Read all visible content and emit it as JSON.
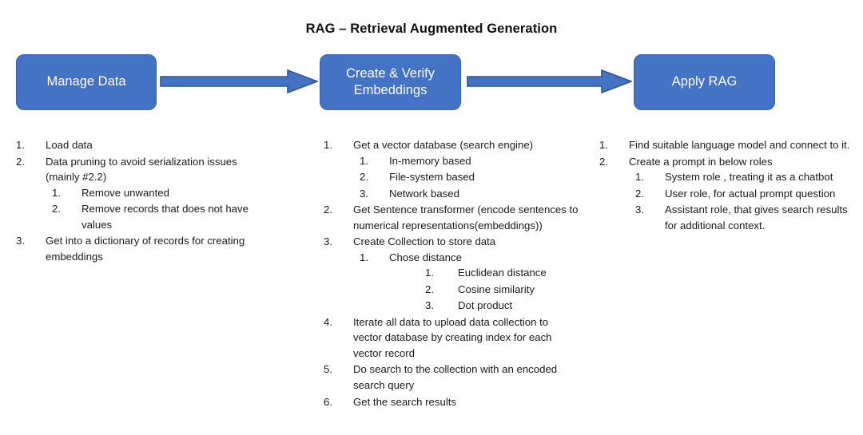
{
  "title": "RAG – Retrieval Augmented Generation",
  "colors": {
    "box_fill": "#4472C4",
    "box_border": "#3A63B0",
    "box_text": "#FFFFFF",
    "arrow_fill": "#4472C4",
    "arrow_border": "#2F5597",
    "page_background": "#FFFFFF",
    "body_text": "#1A1A1A"
  },
  "flow": {
    "boxes": [
      {
        "label": "Manage Data"
      },
      {
        "label": "Create & Verify Embeddings"
      },
      {
        "label": "Apply RAG"
      }
    ],
    "arrows": [
      {
        "name": "arrow-manage-to-embeddings",
        "direction": "right"
      },
      {
        "name": "arrow-embeddings-to-apply",
        "direction": "right"
      }
    ]
  },
  "columns": [
    {
      "name": "manage-data-steps",
      "items": [
        {
          "num": "1.",
          "text": "Load data"
        },
        {
          "num": "2.",
          "text": "Data pruning to avoid serialization issues (mainly #2.2)",
          "children": [
            {
              "num": "1.",
              "text": "Remove unwanted"
            },
            {
              "num": "2.",
              "text": "Remove records that does not have values"
            }
          ]
        },
        {
          "num": "3.",
          "text": "Get into a dictionary of records for creating embeddings"
        }
      ]
    },
    {
      "name": "create-verify-embeddings-steps",
      "items": [
        {
          "num": "1.",
          "text": "Get a vector database (search engine)",
          "children": [
            {
              "num": "1.",
              "text": "In-memory based"
            },
            {
              "num": "2.",
              "text": "File-system based"
            },
            {
              "num": "3.",
              "text": "Network based"
            }
          ]
        },
        {
          "num": "2.",
          "text": "Get Sentence transformer (encode sentences to numerical representations(embeddings))"
        },
        {
          "num": "3.",
          "text": "Create Collection to store data",
          "children": [
            {
              "num": "1.",
              "text": "Chose distance",
              "children": [
                {
                  "num": "1.",
                  "text": "Euclidean distance"
                },
                {
                  "num": "2.",
                  "text": "Cosine similarity"
                },
                {
                  "num": "3.",
                  "text": "Dot product"
                }
              ]
            }
          ]
        },
        {
          "num": "4.",
          "text": "Iterate all data to upload data collection to vector database by creating index for each vector record"
        },
        {
          "num": "5.",
          "text": "Do search to the collection with an encoded search query"
        },
        {
          "num": "6.",
          "text": "Get the search results"
        }
      ]
    },
    {
      "name": "apply-rag-steps",
      "items": [
        {
          "num": "1.",
          "text": "Find suitable language model and connect to it."
        },
        {
          "num": "2.",
          "text": "Create a prompt in below roles",
          "children": [
            {
              "num": "1.",
              "text": "System role , treating it as a chatbot"
            },
            {
              "num": "2.",
              "text": "User role, for actual prompt question"
            },
            {
              "num": "3.",
              "text": "Assistant role, that gives search results for additional context."
            }
          ]
        }
      ]
    }
  ]
}
